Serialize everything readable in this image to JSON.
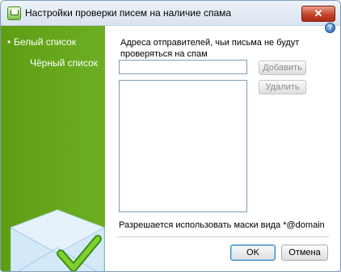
{
  "window": {
    "title": "Настройки проверки писем на наличие спама",
    "close_glyph": "✕"
  },
  "sidebar": {
    "items": [
      {
        "label": "Белый список",
        "bullet": "•",
        "selected": true
      },
      {
        "label": "Чёрный список",
        "bullet": "",
        "selected": false
      }
    ]
  },
  "help": {
    "glyph": "?"
  },
  "main": {
    "description": "Адреса отправителей, чьи письма не будут проверяться на спам",
    "address_input": {
      "value": "",
      "placeholder": ""
    },
    "add_button": "Добавить",
    "delete_button": "Удалить",
    "hint": "Разрешается использовать маски вида *@domain"
  },
  "footer": {
    "ok_button": "OK",
    "cancel_button": "Отмена"
  },
  "colors": {
    "sidebar": "#67a51c",
    "close_button": "#c5442a",
    "checkmark": "#6fc325"
  }
}
